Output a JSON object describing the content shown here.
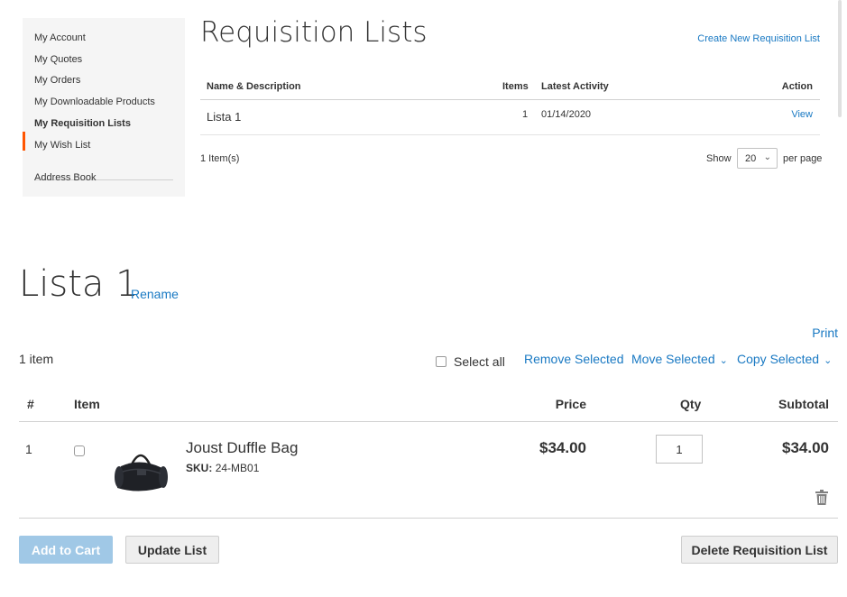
{
  "sidebar": {
    "items": [
      {
        "label": "My Account"
      },
      {
        "label": "My Quotes"
      },
      {
        "label": "My Orders"
      },
      {
        "label": "My Downloadable Products"
      },
      {
        "label": "My Requisition Lists"
      },
      {
        "label": "My Wish List"
      },
      {
        "label": "Address Book"
      }
    ],
    "active_index": 4,
    "accent_color": "#ff5501"
  },
  "requisition_lists": {
    "title": "Requisition Lists",
    "create_link": "Create New Requisition List",
    "columns": {
      "name": "Name & Description",
      "items": "Items",
      "activity": "Latest Activity",
      "action": "Action"
    },
    "rows": [
      {
        "name": "Lista 1",
        "items": "1",
        "activity": "01/14/2020",
        "action": "View"
      }
    ],
    "count_text": "1 Item(s)",
    "limiter": {
      "show": "Show",
      "value": "20",
      "per_page": "per page"
    }
  },
  "list_detail": {
    "title": "Lista 1",
    "rename": "Rename",
    "print": "Print",
    "item_count": "1 item",
    "select_all": "Select all",
    "remove_selected": "Remove Selected",
    "move_selected": "Move Selected",
    "copy_selected": "Copy Selected",
    "columns": {
      "num": "#",
      "item": "Item",
      "price": "Price",
      "qty": "Qty",
      "subtotal": "Subtotal"
    },
    "items": [
      {
        "num": "1",
        "name": "Joust Duffle Bag",
        "sku_label": "SKU:",
        "sku": "24-MB01",
        "price": "$34.00",
        "qty": "1",
        "subtotal": "$34.00",
        "icon": "duffle-bag-image"
      }
    ],
    "buttons": {
      "add_to_cart": "Add to Cart",
      "update_list": "Update List",
      "delete_list": "Delete Requisition List"
    }
  },
  "colors": {
    "link": "#1979c3",
    "primary_disabled": "#a0c8e6",
    "sidebar_bg": "#f5f5f5"
  }
}
